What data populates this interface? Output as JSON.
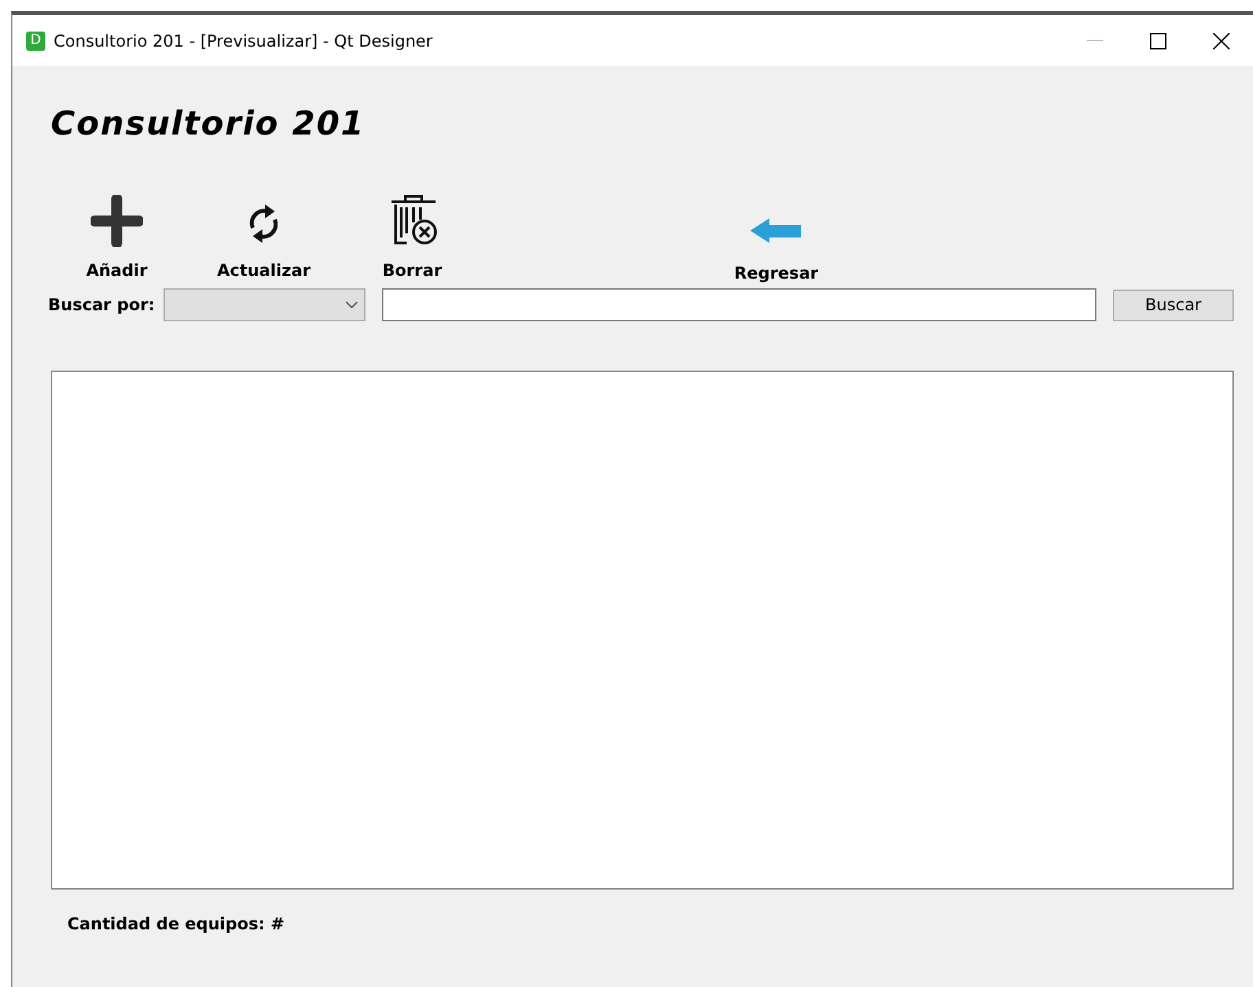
{
  "window": {
    "title": "Consultorio 201 - [Previsualizar] - Qt Designer",
    "app_badge": "D"
  },
  "heading": "Consultorio 201",
  "toolbar": [
    {
      "label": "Añadir",
      "kind": "add"
    },
    {
      "label": "Actualizar",
      "kind": "refresh"
    },
    {
      "label": "Borrar",
      "kind": "delete"
    },
    {
      "label": "Regresar",
      "kind": "back"
    }
  ],
  "search": {
    "label": "Buscar por:",
    "dropdown_disabled": true,
    "button": "Buscar"
  },
  "footer": {
    "label": "Cantidad de equipos:",
    "value": "#"
  }
}
